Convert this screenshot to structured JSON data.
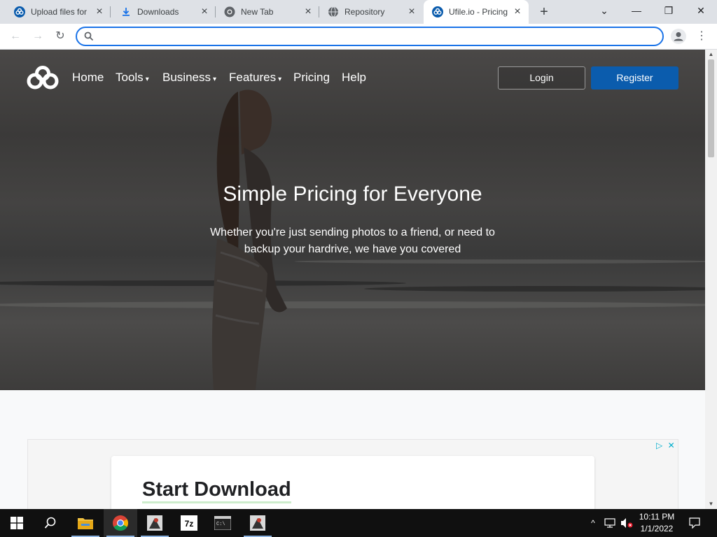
{
  "browser": {
    "tabs": [
      {
        "label": "Upload files for",
        "icon": "ufile-logo-icon",
        "active": false
      },
      {
        "label": "Downloads",
        "icon": "download-icon",
        "active": false
      },
      {
        "label": "New Tab",
        "icon": "chrome-icon",
        "active": false
      },
      {
        "label": "Repository",
        "icon": "globe-icon",
        "active": false
      },
      {
        "label": "Ufile.io - Pricing",
        "icon": "ufile-logo-icon",
        "active": true
      }
    ],
    "new_tab": "+",
    "controls": {
      "tab_search": "⌄",
      "minimize": "—",
      "restore": "❐",
      "close": "✕"
    },
    "toolbar": {
      "back": "←",
      "forward": "→",
      "reload": "↻",
      "menu": "⋮"
    },
    "omnibox": {
      "value": "",
      "placeholder": ""
    }
  },
  "site": {
    "nav": {
      "home": "Home",
      "tools": "Tools",
      "business": "Business",
      "features": "Features",
      "pricing": "Pricing",
      "help": "Help",
      "login": "Login",
      "register": "Register"
    },
    "hero": {
      "title": "Simple Pricing for Everyone",
      "subtitle": "Whether you're just sending photos to a friend, or need to backup your hardrive, we have you covered"
    },
    "ad": {
      "headline": "Start Download"
    }
  },
  "taskbar": {
    "items": [
      "windows-start",
      "search",
      "file-explorer",
      "chrome",
      "app-a",
      "7zip",
      "terminal",
      "app-b"
    ],
    "tray": {
      "time": "10:11 PM",
      "date": "1/1/2022"
    }
  },
  "colors": {
    "accent": "#1a73e8",
    "register": "#0b5cad",
    "tabstrip": "#dee1e6",
    "taskbar": "#101010"
  }
}
